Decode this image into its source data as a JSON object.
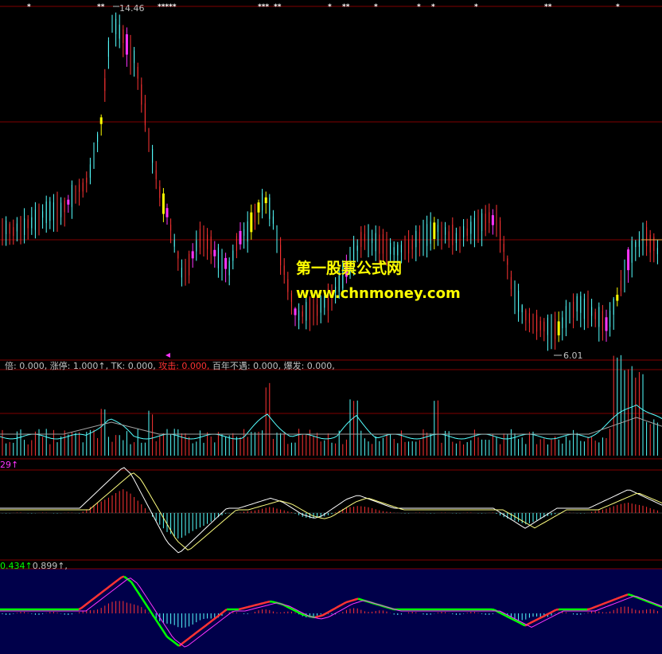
{
  "chart_data": {
    "type": "candlestick",
    "price_panel": {
      "high_label": "14.46",
      "low_label": "6.01",
      "watermark_cn": "第一股票公式网",
      "watermark_url": "www.chnmoney.com",
      "signal_marks": [
        "*",
        "**",
        "*****",
        "***",
        "**",
        "*",
        "**",
        "*",
        "*",
        "*",
        "*",
        "**",
        "*"
      ]
    },
    "indicator_line": [
      {
        "text": "倍: 0.000, ",
        "color": "#c0c0c0"
      },
      {
        "text": "涨停: 1.000↑, ",
        "color": "#c0c0c0"
      },
      {
        "text": "TK: 0.000, ",
        "color": "#c0c0c0"
      },
      {
        "text": "攻击: 0.000, ",
        "color": "#ff3333"
      },
      {
        "text": "百年不遇: 0.000, ",
        "color": "#c0c0c0"
      },
      {
        "text": "爆发: 0.000,",
        "color": "#c0c0c0"
      }
    ],
    "macd_label": "29↑",
    "bottom_label_1": "0.434↑",
    "bottom_label_2": "0.899↑,"
  },
  "colors": {
    "up": "#ff3333",
    "down": "#54ffff",
    "yellow": "#ffff00",
    "magenta": "#ff33ff",
    "grid": "#800000",
    "navy": "#00004a",
    "green": "#00ff00"
  }
}
